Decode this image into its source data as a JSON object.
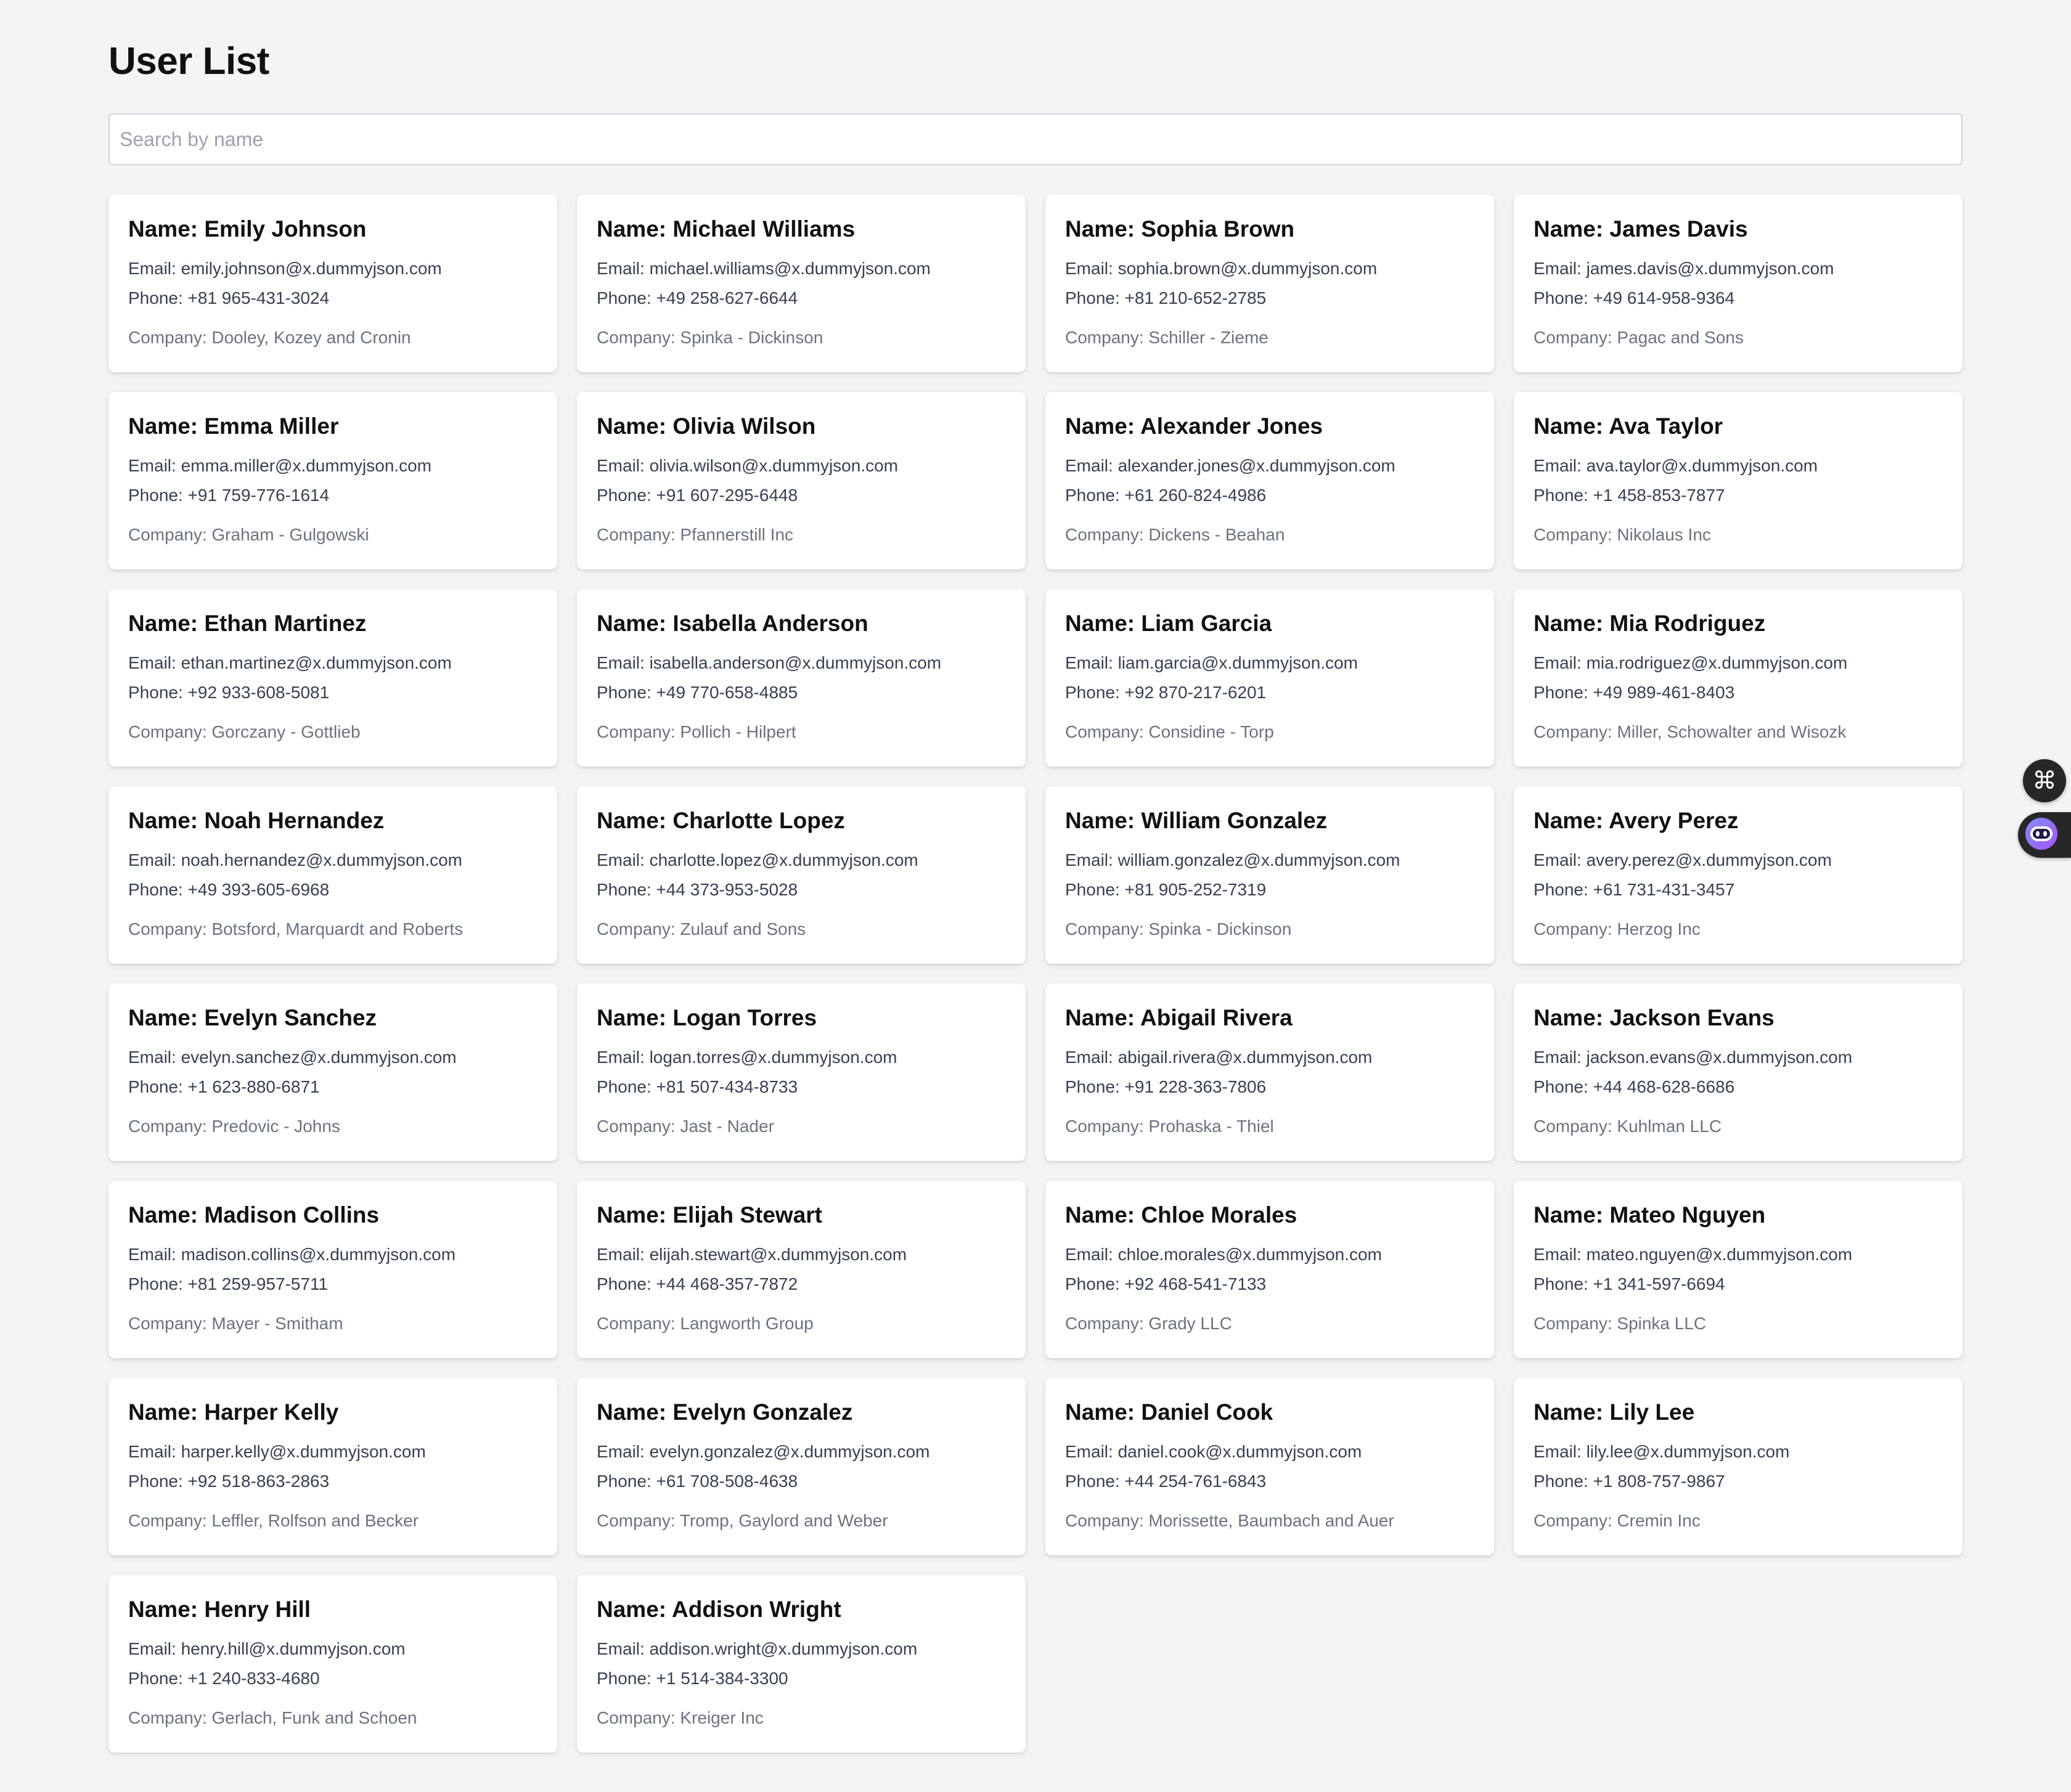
{
  "page": {
    "title": "User List"
  },
  "search": {
    "placeholder": "Search by name",
    "value": ""
  },
  "users": [
    {
      "name": "Name: Emily Johnson",
      "email": "Email: emily.johnson@x.dummyjson.com",
      "phone": "Phone: +81 965-431-3024",
      "company": "Company: Dooley, Kozey and Cronin"
    },
    {
      "name": "Name: Michael Williams",
      "email": "Email: michael.williams@x.dummyjson.com",
      "phone": "Phone: +49 258-627-6644",
      "company": "Company: Spinka - Dickinson"
    },
    {
      "name": "Name: Sophia Brown",
      "email": "Email: sophia.brown@x.dummyjson.com",
      "phone": "Phone: +81 210-652-2785",
      "company": "Company: Schiller - Zieme"
    },
    {
      "name": "Name: James Davis",
      "email": "Email: james.davis@x.dummyjson.com",
      "phone": "Phone: +49 614-958-9364",
      "company": "Company: Pagac and Sons"
    },
    {
      "name": "Name: Emma Miller",
      "email": "Email: emma.miller@x.dummyjson.com",
      "phone": "Phone: +91 759-776-1614",
      "company": "Company: Graham - Gulgowski"
    },
    {
      "name": "Name: Olivia Wilson",
      "email": "Email: olivia.wilson@x.dummyjson.com",
      "phone": "Phone: +91 607-295-6448",
      "company": "Company: Pfannerstill Inc"
    },
    {
      "name": "Name: Alexander Jones",
      "email": "Email: alexander.jones@x.dummyjson.com",
      "phone": "Phone: +61 260-824-4986",
      "company": "Company: Dickens - Beahan"
    },
    {
      "name": "Name: Ava Taylor",
      "email": "Email: ava.taylor@x.dummyjson.com",
      "phone": "Phone: +1 458-853-7877",
      "company": "Company: Nikolaus Inc"
    },
    {
      "name": "Name: Ethan Martinez",
      "email": "Email: ethan.martinez@x.dummyjson.com",
      "phone": "Phone: +92 933-608-5081",
      "company": "Company: Gorczany - Gottlieb"
    },
    {
      "name": "Name: Isabella Anderson",
      "email": "Email: isabella.anderson@x.dummyjson.com",
      "phone": "Phone: +49 770-658-4885",
      "company": "Company: Pollich - Hilpert"
    },
    {
      "name": "Name: Liam Garcia",
      "email": "Email: liam.garcia@x.dummyjson.com",
      "phone": "Phone: +92 870-217-6201",
      "company": "Company: Considine - Torp"
    },
    {
      "name": "Name: Mia Rodriguez",
      "email": "Email: mia.rodriguez@x.dummyjson.com",
      "phone": "Phone: +49 989-461-8403",
      "company": "Company: Miller, Schowalter and Wisozk"
    },
    {
      "name": "Name: Noah Hernandez",
      "email": "Email: noah.hernandez@x.dummyjson.com",
      "phone": "Phone: +49 393-605-6968",
      "company": "Company: Botsford, Marquardt and Roberts"
    },
    {
      "name": "Name: Charlotte Lopez",
      "email": "Email: charlotte.lopez@x.dummyjson.com",
      "phone": "Phone: +44 373-953-5028",
      "company": "Company: Zulauf and Sons"
    },
    {
      "name": "Name: William Gonzalez",
      "email": "Email: william.gonzalez@x.dummyjson.com",
      "phone": "Phone: +81 905-252-7319",
      "company": "Company: Spinka - Dickinson"
    },
    {
      "name": "Name: Avery Perez",
      "email": "Email: avery.perez@x.dummyjson.com",
      "phone": "Phone: +61 731-431-3457",
      "company": "Company: Herzog Inc"
    },
    {
      "name": "Name: Evelyn Sanchez",
      "email": "Email: evelyn.sanchez@x.dummyjson.com",
      "phone": "Phone: +1 623-880-6871",
      "company": "Company: Predovic - Johns"
    },
    {
      "name": "Name: Logan Torres",
      "email": "Email: logan.torres@x.dummyjson.com",
      "phone": "Phone: +81 507-434-8733",
      "company": "Company: Jast - Nader"
    },
    {
      "name": "Name: Abigail Rivera",
      "email": "Email: abigail.rivera@x.dummyjson.com",
      "phone": "Phone: +91 228-363-7806",
      "company": "Company: Prohaska - Thiel"
    },
    {
      "name": "Name: Jackson Evans",
      "email": "Email: jackson.evans@x.dummyjson.com",
      "phone": "Phone: +44 468-628-6686",
      "company": "Company: Kuhlman LLC"
    },
    {
      "name": "Name: Madison Collins",
      "email": "Email: madison.collins@x.dummyjson.com",
      "phone": "Phone: +81 259-957-5711",
      "company": "Company: Mayer - Smitham"
    },
    {
      "name": "Name: Elijah Stewart",
      "email": "Email: elijah.stewart@x.dummyjson.com",
      "phone": "Phone: +44 468-357-7872",
      "company": "Company: Langworth Group"
    },
    {
      "name": "Name: Chloe Morales",
      "email": "Email: chloe.morales@x.dummyjson.com",
      "phone": "Phone: +92 468-541-7133",
      "company": "Company: Grady LLC"
    },
    {
      "name": "Name: Mateo Nguyen",
      "email": "Email: mateo.nguyen@x.dummyjson.com",
      "phone": "Phone: +1 341-597-6694",
      "company": "Company: Spinka LLC"
    },
    {
      "name": "Name: Harper Kelly",
      "email": "Email: harper.kelly@x.dummyjson.com",
      "phone": "Phone: +92 518-863-2863",
      "company": "Company: Leffler, Rolfson and Becker"
    },
    {
      "name": "Name: Evelyn Gonzalez",
      "email": "Email: evelyn.gonzalez@x.dummyjson.com",
      "phone": "Phone: +61 708-508-4638",
      "company": "Company: Tromp, Gaylord and Weber"
    },
    {
      "name": "Name: Daniel Cook",
      "email": "Email: daniel.cook@x.dummyjson.com",
      "phone": "Phone: +44 254-761-6843",
      "company": "Company: Morissette, Baumbach and Auer"
    },
    {
      "name": "Name: Lily Lee",
      "email": "Email: lily.lee@x.dummyjson.com",
      "phone": "Phone: +1 808-757-9867",
      "company": "Company: Cremin Inc"
    },
    {
      "name": "Name: Henry Hill",
      "email": "Email: henry.hill@x.dummyjson.com",
      "phone": "Phone: +1 240-833-4680",
      "company": "Company: Gerlach, Funk and Schoen"
    },
    {
      "name": "Name: Addison Wright",
      "email": "Email: addison.wright@x.dummyjson.com",
      "phone": "Phone: +1 514-384-3300",
      "company": "Company: Kreiger Inc"
    }
  ],
  "floating": {
    "grid_icon": "command-icon",
    "bot_icon": "bot-icon"
  },
  "colors": {
    "background": "#f3f4f6",
    "card": "#ffffff",
    "float_button": "#27272a",
    "bot_accent": "#6366f1"
  }
}
